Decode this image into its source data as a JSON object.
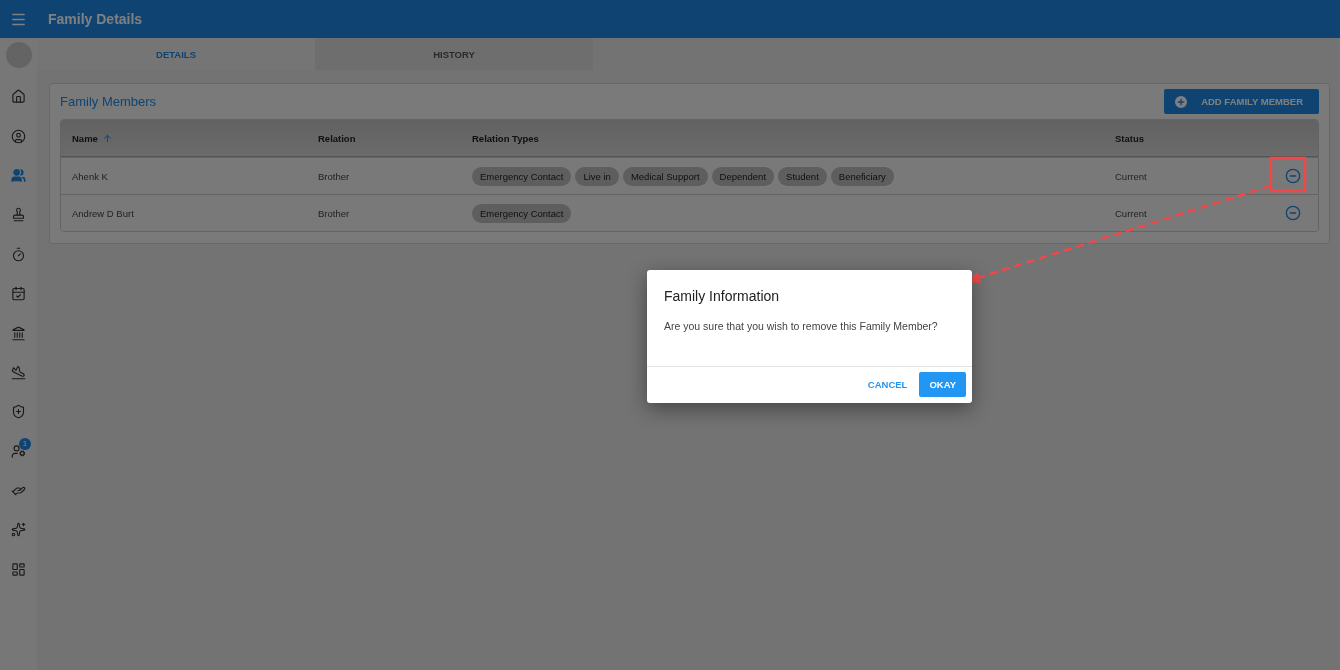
{
  "header": {
    "title": "Family Details"
  },
  "sidebar": {
    "items": [
      {
        "selected": false
      },
      {
        "selected": false
      },
      {
        "selected": true
      },
      {
        "selected": false
      },
      {
        "selected": false
      },
      {
        "selected": false
      },
      {
        "selected": false
      },
      {
        "selected": false
      },
      {
        "selected": false
      },
      {
        "selected": false,
        "badge": "1"
      },
      {
        "selected": false
      },
      {
        "selected": false
      },
      {
        "selected": false
      }
    ]
  },
  "tabs": [
    {
      "label": "DETAILS",
      "selected": true
    },
    {
      "label": "HISTORY",
      "selected": false
    }
  ],
  "card": {
    "title": "Family Members",
    "add_button": "ADD FAMILY MEMBER"
  },
  "table": {
    "columns": [
      {
        "label": "Name",
        "sorted": true
      },
      {
        "label": "Relation",
        "sorted": false
      },
      {
        "label": "Relation Types",
        "sorted": false
      },
      {
        "label": "Status",
        "sorted": false
      }
    ],
    "rows": [
      {
        "name": "Ahenk K",
        "relation": "Brother",
        "relation_types": [
          "Emergency Contact",
          "Live in",
          "Medical Support",
          "Dependent",
          "Student",
          "Beneficiary"
        ],
        "status": "Current",
        "highlighted": true
      },
      {
        "name": "Andrew D Burt",
        "relation": "Brother",
        "relation_types": [
          "Emergency Contact"
        ],
        "status": "Current",
        "highlighted": false
      }
    ]
  },
  "dialog": {
    "title": "Family Information",
    "message": "Are you sure that you wish to remove this Family Member?",
    "buttons": [
      {
        "label": "CANCEL",
        "kind": "text"
      },
      {
        "label": "OKAY",
        "kind": "primary"
      }
    ]
  }
}
